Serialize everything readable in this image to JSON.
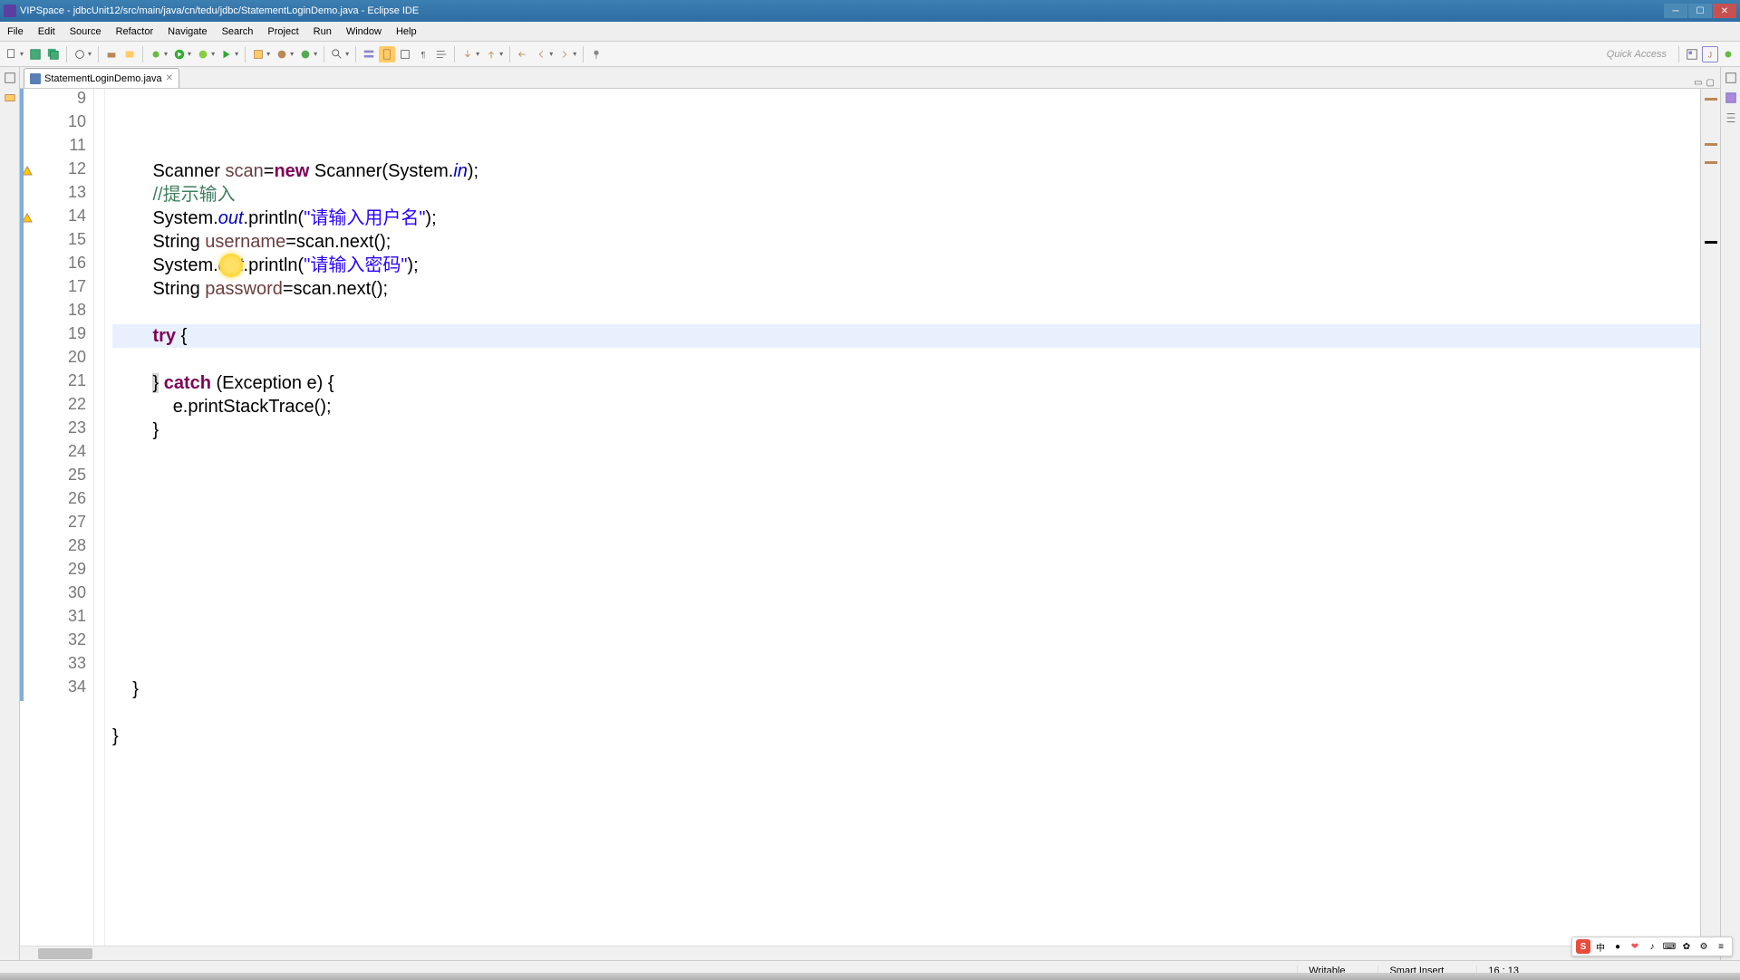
{
  "window": {
    "title": "VIPSpace - jdbcUnit12/src/main/java/cn/tedu/jdbc/StatementLoginDemo.java - Eclipse IDE"
  },
  "menu": {
    "items": [
      "File",
      "Edit",
      "Source",
      "Refactor",
      "Navigate",
      "Search",
      "Project",
      "Run",
      "Window",
      "Help"
    ]
  },
  "toolbar": {
    "quick_access": "Quick Access"
  },
  "tab": {
    "filename": "StatementLoginDemo.java"
  },
  "code": {
    "lines": [
      {
        "n": 9,
        "indent": 2,
        "tokens": [
          [
            "typ",
            "Scanner "
          ],
          [
            "var",
            "scan"
          ],
          [
            "typ",
            "="
          ],
          [
            "kw",
            "new"
          ],
          [
            "typ",
            " Scanner(System."
          ],
          [
            "fld",
            "in"
          ],
          [
            "typ",
            ");"
          ]
        ]
      },
      {
        "n": 10,
        "indent": 2,
        "tokens": [
          [
            "cmt",
            "//提示输入"
          ]
        ]
      },
      {
        "n": 11,
        "indent": 2,
        "tokens": [
          [
            "typ",
            "System."
          ],
          [
            "fld",
            "out"
          ],
          [
            "typ",
            ".println("
          ],
          [
            "str",
            "\"请输入用户名\""
          ],
          [
            "typ",
            ");"
          ]
        ]
      },
      {
        "n": 12,
        "indent": 2,
        "tokens": [
          [
            "typ",
            "String "
          ],
          [
            "var",
            "username"
          ],
          [
            "typ",
            "=scan.next();"
          ]
        ],
        "warn": true
      },
      {
        "n": 13,
        "indent": 2,
        "tokens": [
          [
            "typ",
            "System."
          ],
          [
            "fld",
            "out"
          ],
          [
            "typ",
            ".println("
          ],
          [
            "str",
            "\"请输入密码\""
          ],
          [
            "typ",
            ");"
          ]
        ]
      },
      {
        "n": 14,
        "indent": 2,
        "tokens": [
          [
            "typ",
            "String "
          ],
          [
            "var",
            "password"
          ],
          [
            "typ",
            "=scan.next();"
          ]
        ],
        "warn": true
      },
      {
        "n": 15,
        "indent": 2,
        "tokens": []
      },
      {
        "n": 16,
        "indent": 2,
        "tokens": [
          [
            "kw",
            "try"
          ],
          [
            "typ",
            " {"
          ]
        ],
        "current": true
      },
      {
        "n": 17,
        "indent": 3,
        "tokens": []
      },
      {
        "n": 18,
        "indent": 2,
        "tokens": [
          [
            "typ",
            "} "
          ],
          [
            "kw",
            "catch"
          ],
          [
            "typ",
            " (Exception e) {"
          ]
        ],
        "match": true
      },
      {
        "n": 19,
        "indent": 3,
        "tokens": [
          [
            "typ",
            "e.printStackTrace();"
          ]
        ]
      },
      {
        "n": 20,
        "indent": 2,
        "tokens": [
          [
            "typ",
            "}"
          ]
        ]
      },
      {
        "n": 21,
        "indent": 2,
        "tokens": []
      },
      {
        "n": 22,
        "indent": 2,
        "tokens": []
      },
      {
        "n": 23,
        "indent": 2,
        "tokens": []
      },
      {
        "n": 24,
        "indent": 2,
        "tokens": []
      },
      {
        "n": 25,
        "indent": 2,
        "tokens": []
      },
      {
        "n": 26,
        "indent": 2,
        "tokens": []
      },
      {
        "n": 27,
        "indent": 2,
        "tokens": []
      },
      {
        "n": 28,
        "indent": 2,
        "tokens": []
      },
      {
        "n": 29,
        "indent": 2,
        "tokens": []
      },
      {
        "n": 30,
        "indent": 2,
        "tokens": []
      },
      {
        "n": 31,
        "indent": 1,
        "tokens": [
          [
            "typ",
            "}"
          ]
        ]
      },
      {
        "n": 32,
        "indent": 0,
        "tokens": []
      },
      {
        "n": 33,
        "indent": 0,
        "tokens": [
          [
            "typ",
            "}"
          ]
        ]
      },
      {
        "n": 34,
        "indent": 0,
        "tokens": []
      }
    ]
  },
  "status": {
    "writable": "Writable",
    "insert": "Smart Insert",
    "pos": "16 : 13"
  },
  "ime": {
    "sogou": "S",
    "items": [
      "中",
      "●",
      "❤",
      "♪",
      "⌨",
      "✿",
      "⚙",
      "≡"
    ]
  }
}
